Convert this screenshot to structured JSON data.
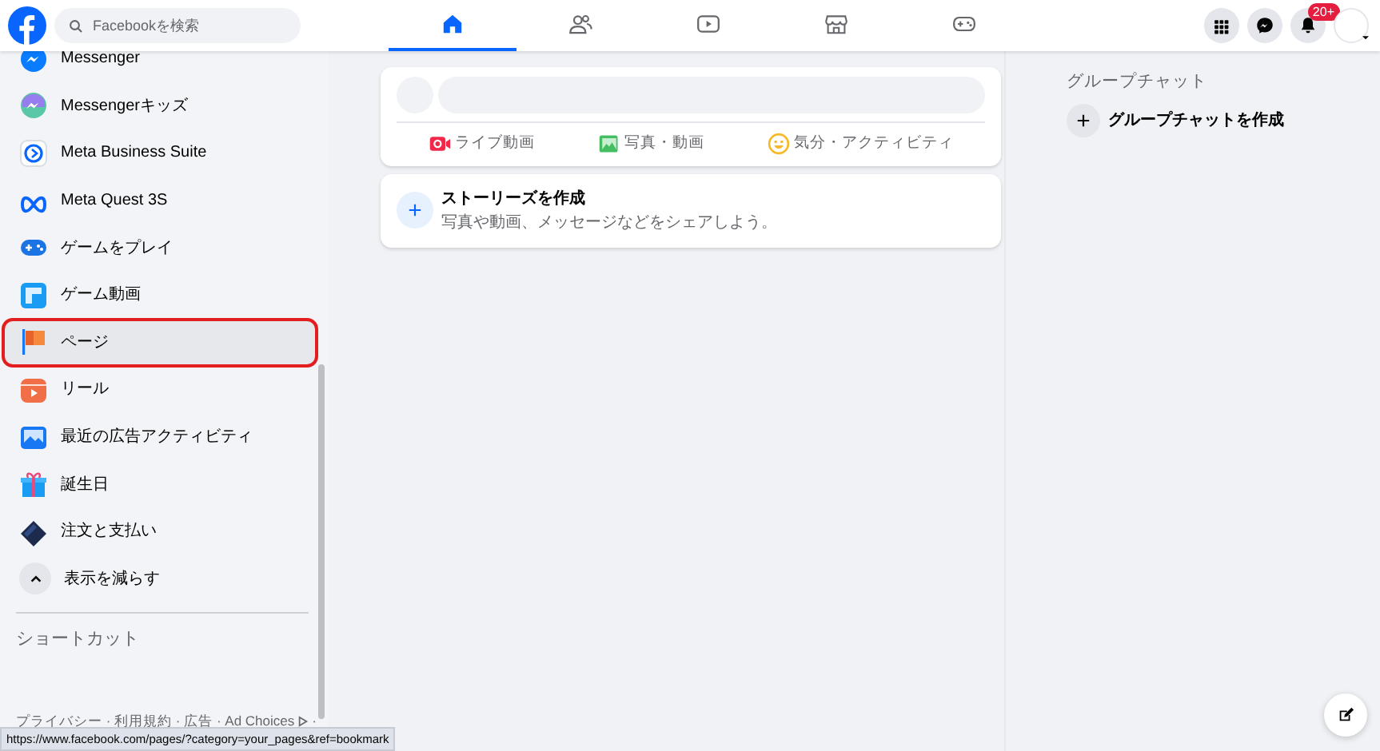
{
  "search": {
    "placeholder": "Facebookを検索"
  },
  "nav_tabs": [
    {
      "kind": "home",
      "selected": true
    },
    {
      "kind": "friends",
      "selected": false
    },
    {
      "kind": "video",
      "selected": false
    },
    {
      "kind": "marketplace",
      "selected": false
    },
    {
      "kind": "gaming",
      "selected": false
    }
  ],
  "header_buttons": [
    {
      "kind": "menu"
    },
    {
      "kind": "messenger"
    },
    {
      "kind": "notifications",
      "badge": "20+"
    },
    {
      "kind": "account"
    }
  ],
  "sidebar": {
    "items": [
      {
        "kind": "messenger",
        "label": "Messenger",
        "selected": false
      },
      {
        "kind": "messenger-kids",
        "label": "Messengerキッズ",
        "selected": false
      },
      {
        "kind": "business",
        "label": "Meta Business Suite",
        "selected": false
      },
      {
        "kind": "quest",
        "label": "Meta Quest 3S",
        "selected": false
      },
      {
        "kind": "play",
        "label": "ゲームをプレイ",
        "selected": false
      },
      {
        "kind": "gamevideo",
        "label": "ゲーム動画",
        "selected": false
      },
      {
        "kind": "pages",
        "label": "ページ",
        "selected": true
      },
      {
        "kind": "reels",
        "label": "リール",
        "selected": false
      },
      {
        "kind": "ads",
        "label": "最近の広告アクティビティ",
        "selected": false
      },
      {
        "kind": "birthday",
        "label": "誕生日",
        "selected": false
      },
      {
        "kind": "payments",
        "label": "注文と支払い",
        "selected": false
      }
    ],
    "toggle": {
      "label": "表示を減らす",
      "expanded": true
    },
    "shortcuts_heading": "ショートカット",
    "footer": {
      "text": "プライバシー · 利用規約 · 広告 · Ad Choices",
      "tail": "·"
    }
  },
  "composer": {
    "actions": [
      {
        "kind": "live",
        "label": "ライブ動画"
      },
      {
        "kind": "photo",
        "label": "写真・動画"
      },
      {
        "kind": "feeling",
        "label": "気分・アクティビティ"
      }
    ]
  },
  "story": {
    "title": "ストーリーズを作成",
    "subtitle": "写真や動画、メッセージなどをシェアしよう。"
  },
  "right": {
    "heading": "グループチャット",
    "create_label": "グループチャットを作成"
  },
  "status_bar": {
    "url": "https://www.facebook.com/pages/?category=your_pages&ref=bookmark"
  }
}
